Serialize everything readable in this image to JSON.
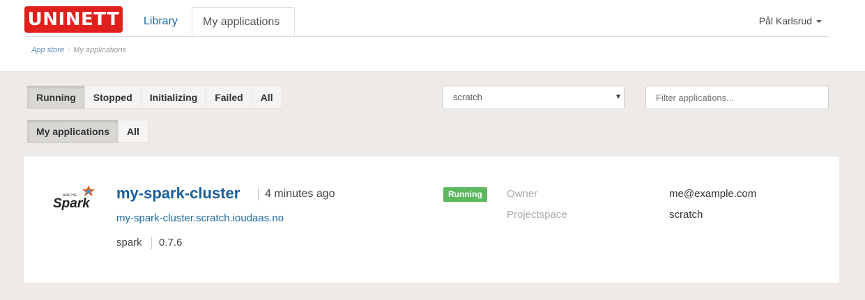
{
  "header": {
    "logo_text": "UNINETT",
    "nav": {
      "library": "Library",
      "my_applications": "My applications"
    },
    "user": "Pål Karlsrud"
  },
  "breadcrumb": {
    "root": "App store",
    "separator": "/",
    "current": "My applications"
  },
  "filters": {
    "status": [
      "Running",
      "Stopped",
      "Initializing",
      "Failed",
      "All"
    ],
    "status_active": "Running",
    "owner": [
      "My applications",
      "All"
    ],
    "owner_active": "My applications",
    "projectspace_select": "scratch",
    "search_placeholder": "Filter applications..."
  },
  "application": {
    "logo_text": "Spark",
    "logo_sub": "APACHE",
    "name": "my-spark-cluster",
    "age": "4 minutes ago",
    "url": "my-spark-cluster.scratch.ioudaas.no",
    "chart": "spark",
    "version": "0.7.6",
    "status": "Running",
    "owner_label": "Owner",
    "owner_value": "me@example.com",
    "projectspace_label": "Projectspace",
    "projectspace_value": "scratch"
  },
  "colors": {
    "brand": "#e1201d",
    "link": "#1a6aa8",
    "status_running": "#5cb85c",
    "background": "#edeae7"
  }
}
